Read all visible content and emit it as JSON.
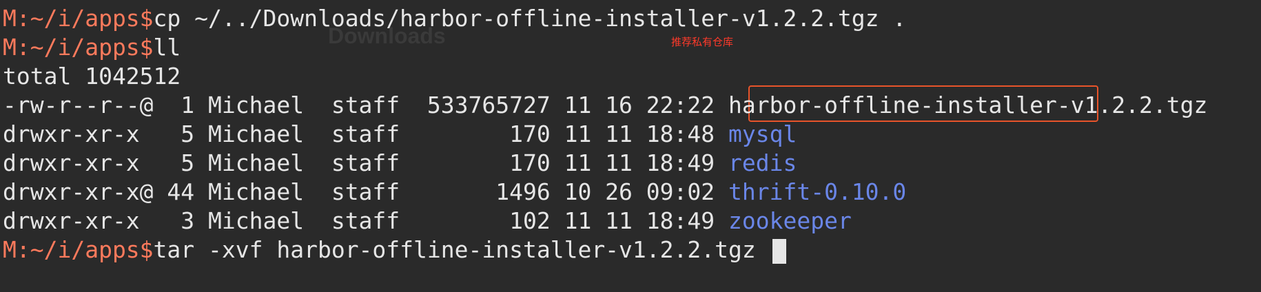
{
  "background_ghost": {
    "title": "Downloads"
  },
  "annotation": "推荐私有仓库",
  "lines": [
    {
      "prompt": "M:~/i/apps$",
      "text": "cp ~/../Downloads/harbor-offline-installer-v1.2.2.tgz ."
    },
    {
      "prompt": "M:~/i/apps$",
      "text": "ll"
    },
    {
      "text": "total 1042512"
    },
    {
      "meta": "-rw-r--r--@  1 Michael  staff  533765727 11 16 22:22 ",
      "name_highlight": "harbor-offline-installer",
      "name_rest": "-v1.2.2.tgz"
    },
    {
      "meta": "drwxr-xr-x   5 Michael  staff        170 11 11 18:48 ",
      "name": "mysql"
    },
    {
      "meta": "drwxr-xr-x   5 Michael  staff        170 11 11 18:49 ",
      "name": "redis"
    },
    {
      "meta": "drwxr-xr-x@ 44 Michael  staff       1496 10 26 09:02 ",
      "name": "thrift-0.10.0"
    },
    {
      "meta": "drwxr-xr-x   3 Michael  staff        102 11 11 18:49 ",
      "name": "zookeeper"
    },
    {
      "prompt": "M:~/i/apps$",
      "text": "tar -xvf harbor-offline-installer-v1.2.2.tgz "
    }
  ],
  "colors": {
    "background": "#2a2a2a",
    "text": "#e6e6e6",
    "prompt": "#ff7a5c",
    "directory": "#6a86e8",
    "highlight_box": "#e8542a",
    "annotation": "#ff3a2a"
  }
}
